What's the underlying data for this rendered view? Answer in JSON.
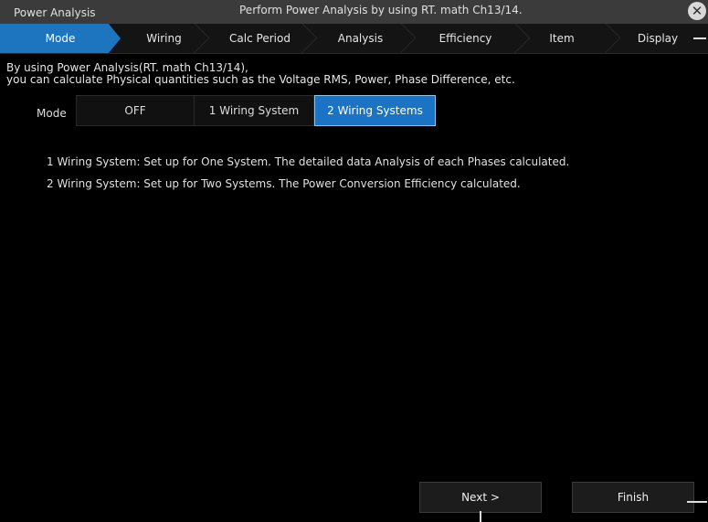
{
  "titlebar": {
    "app_title": "Power Analysis",
    "task_title": "Perform Power Analysis by using RT. math Ch13/14.",
    "close_icon": "close-circle-icon"
  },
  "steps": [
    {
      "label": "Mode",
      "active": true
    },
    {
      "label": "Wiring",
      "active": false
    },
    {
      "label": "Calc Period",
      "active": false
    },
    {
      "label": "Analysis",
      "active": false
    },
    {
      "label": "Efficiency",
      "active": false
    },
    {
      "label": "Item",
      "active": false
    },
    {
      "label": "Display",
      "active": false
    }
  ],
  "description": {
    "line1": "By using Power Analysis(RT. math Ch13/14),",
    "line2": "you can calculate Physical quantities such as the Voltage RMS, Power, Phase Difference, etc."
  },
  "mode": {
    "label": "Mode",
    "options": [
      "OFF",
      "1 Wiring System",
      "2 Wiring Systems"
    ],
    "selected": "2 Wiring Systems"
  },
  "info": {
    "line1": "1 Wiring System: Set up for One System. The detailed data Analysis of each Phases calculated.",
    "line2": "2 Wiring System: Set up for Two Systems. The Power Conversion Efficiency calculated."
  },
  "buttons": {
    "next": "Next >",
    "finish": "Finish"
  },
  "colors": {
    "accent": "#1d75bf",
    "background": "#000000",
    "titlebar": "#3b3b3b"
  }
}
